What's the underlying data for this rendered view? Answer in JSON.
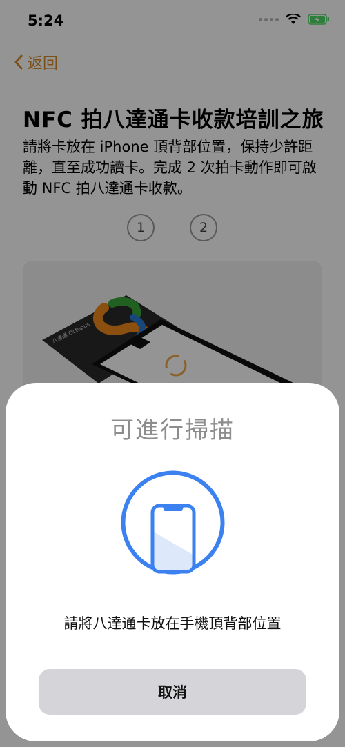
{
  "status_bar": {
    "time": "5:24",
    "wifi_icon": "wifi-icon",
    "battery_icon": "battery-charging-icon"
  },
  "nav": {
    "back_label": "返回",
    "back_icon": "chevron-left-icon"
  },
  "main": {
    "title": "NFC 拍八達通卡收款培訓之旅",
    "description": "請將卡放在 iPhone 頂背部位置，保持少許距離，直至成功讀卡。完成 2 次拍卡動作即可啟動 NFC 拍八達通卡收款。",
    "steps": [
      "1",
      "2"
    ],
    "card_brand": "八達通 Octopus"
  },
  "scan_sheet": {
    "title": "可進行掃描",
    "icon": "phone-scan-icon",
    "message": "請將八達通卡放在手機頂背部位置",
    "cancel_label": "取消"
  },
  "colors": {
    "accent": "#d4892a",
    "scan_blue": "#3b82f0",
    "sheet_button": "#d4d4d9"
  }
}
